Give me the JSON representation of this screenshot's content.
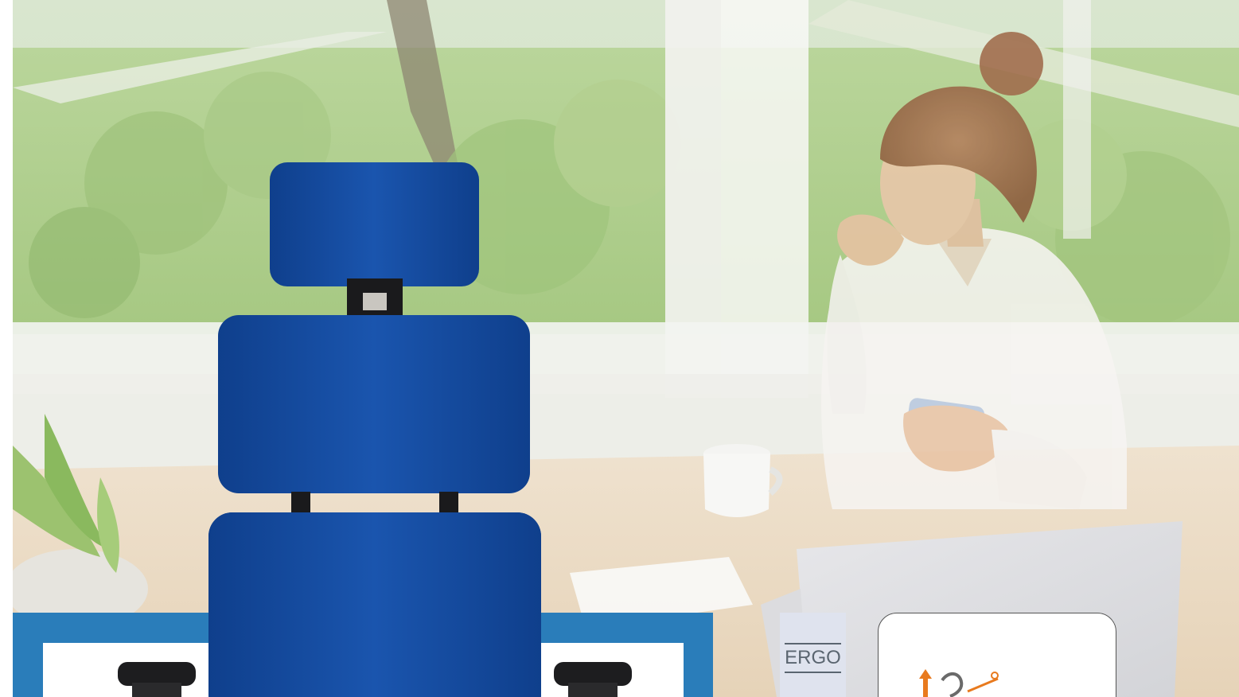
{
  "ergo_tab": {
    "label": "ERGO"
  },
  "feature_card": {
    "icon": "height-adjust-icon"
  },
  "colors": {
    "chair_blue": "#14489a",
    "frame_blue": "#2a7dba",
    "accent_orange": "#e87a1e",
    "ergo_tab_bg": "#dfe3ee"
  }
}
